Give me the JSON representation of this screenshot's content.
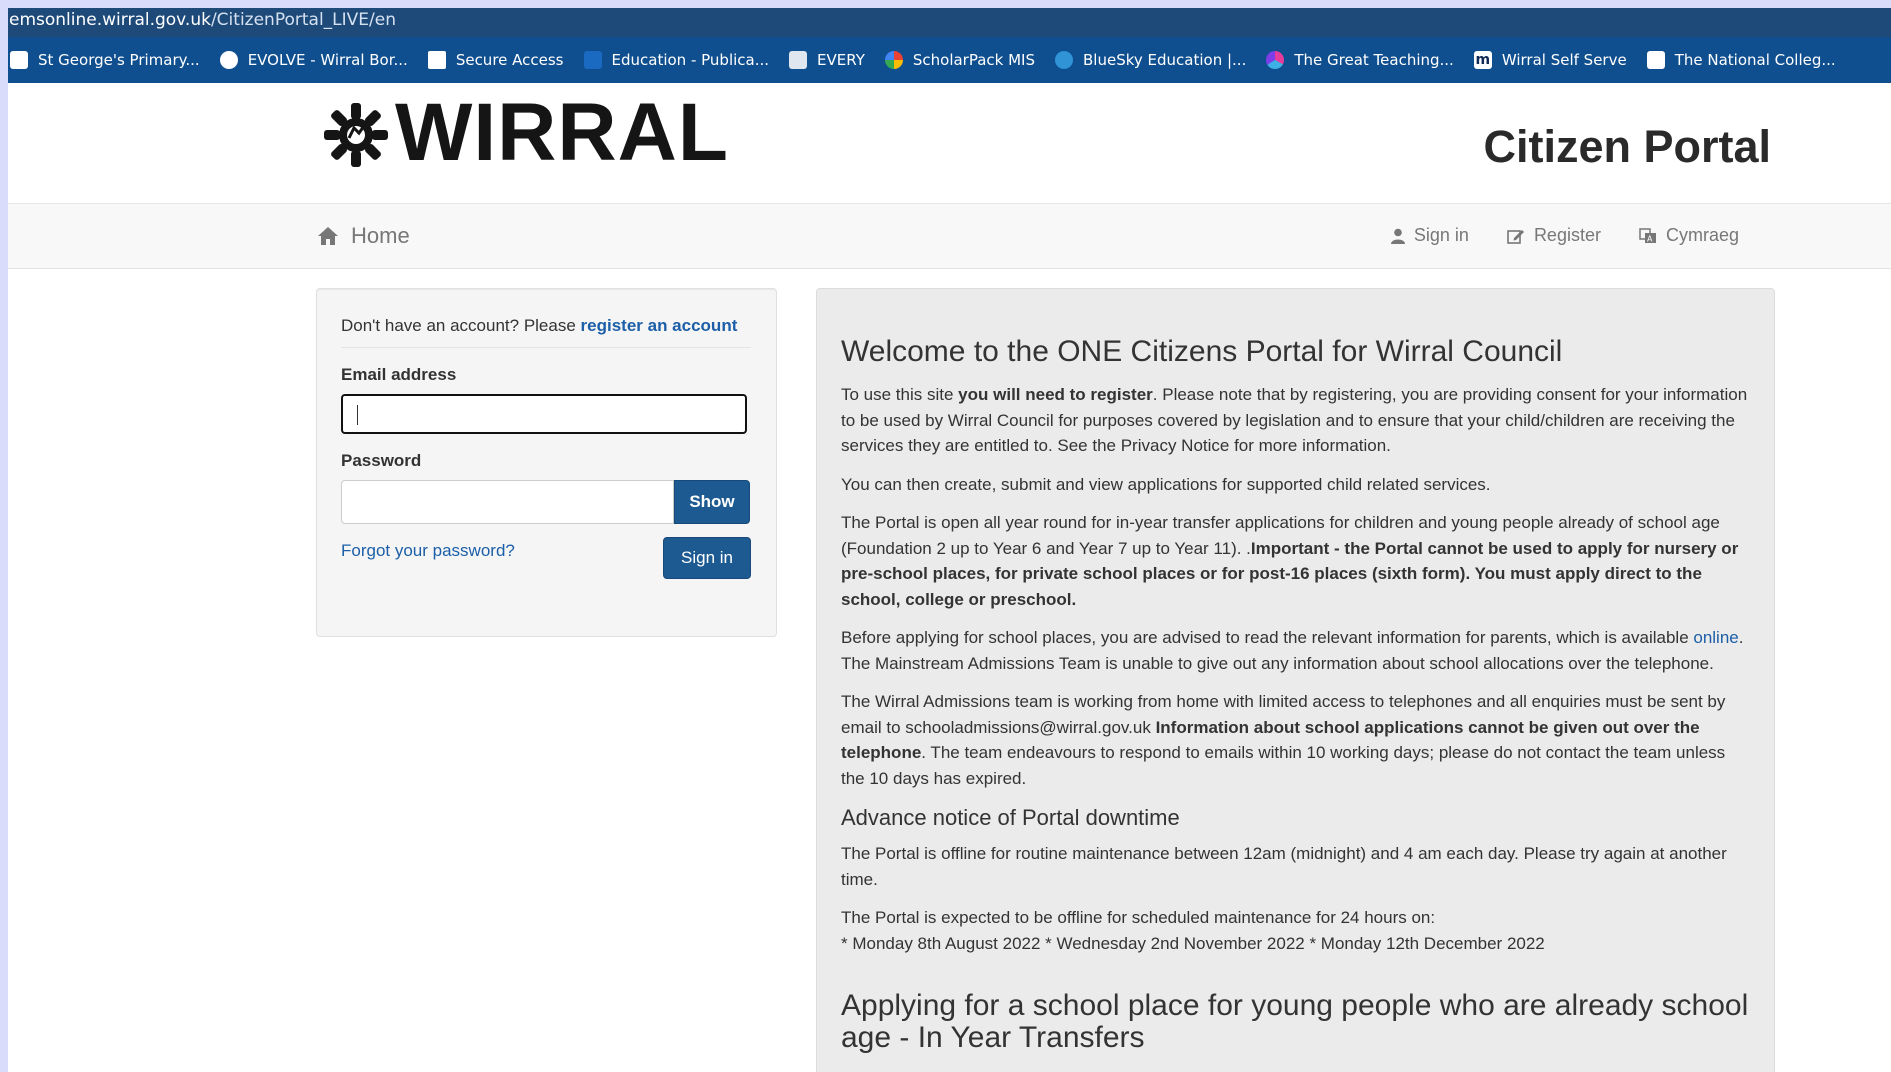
{
  "browser": {
    "url_domain": "emsonline.wirral.gov.uk",
    "url_path": "/CitizenPortal_LIVE/en",
    "bookmarks": [
      {
        "label": "St George's Primary...",
        "icon": "school-icon"
      },
      {
        "label": "EVOLVE - Wirral Bor...",
        "icon": "globe-icon"
      },
      {
        "label": "Secure Access",
        "icon": "crown-icon"
      },
      {
        "label": "Education - Publica...",
        "icon": "education-icon"
      },
      {
        "label": "EVERY",
        "icon": "document-icon"
      },
      {
        "label": "ScholarPack MIS",
        "icon": "scholarpack-icon"
      },
      {
        "label": "BlueSky Education |...",
        "icon": "cloud-icon"
      },
      {
        "label": "The Great Teaching...",
        "icon": "flower-icon"
      },
      {
        "label": "Wirral Self Serve",
        "icon": "m-icon"
      },
      {
        "label": "The National Colleg...",
        "icon": "college-icon"
      }
    ]
  },
  "header": {
    "logo_text": "WIRRAL",
    "title": "Citizen Portal"
  },
  "nav": {
    "home": "Home",
    "sign_in": "Sign in",
    "register": "Register",
    "language": "Cymraeg"
  },
  "login": {
    "no_account_text": "Don't have an account? Please ",
    "register_link": "register an account",
    "email_label": "Email address",
    "email_value": "",
    "password_label": "Password",
    "password_value": "",
    "show_button": "Show",
    "forgot_link": "Forgot your password?",
    "signin_button": "Sign in"
  },
  "info": {
    "welcome_heading": "Welcome to the ONE Citizens Portal for Wirral Council",
    "p1_a": "To use this site ",
    "p1_b": "you will need to register",
    "p1_c": ". Please note that by registering, you are providing consent for your information to be used by Wirral Council for purposes covered by legislation and to ensure that your child/children are receiving the services they are entitled to. See the Privacy Notice for more information.",
    "p2": "You can then create, submit and view applications for supported child related services.",
    "p3_a": "The Portal is open all year round for in-year transfer applications for children and young people already of school age (Foundation 2 up to Year 6 and Year 7 up to Year 11). .",
    "p3_b": "Important - the Portal cannot be used to apply for nursery or pre-school places, for private school places or for post-16 places (sixth form). You must apply direct to the school, college or preschool.",
    "p4_a": "Before applying for school places, you are advised to read the relevant information for parents, which is available ",
    "p4_link": "online",
    "p4_b": ". The Mainstream Admissions Team is unable to give out any information about school allocations over the telephone.",
    "p5_a": "The Wirral Admissions team is working from home with limited access to telephones and all enquiries must be sent by email to schooladmissions@wirral.gov.uk ",
    "p5_b": "Information about school applications cannot be given out over the telephone",
    "p5_c": ". The team endeavours to respond to emails within 10 working days; please do not contact the team unless the 10 days has expired.",
    "downtime_heading": "Advance notice of Portal downtime",
    "p6": "The Portal is offline for routine maintenance between 12am (midnight) and 4 am each day. Please try again at another time.",
    "p7_line1": "The Portal is expected to be offline for scheduled maintenance for 24 hours on:",
    "p7_line2": "* Monday 8th August 2022 * Wednesday 2nd November 2022 * Monday 12th December 2022",
    "transfer_heading": "Applying for a school place for young people who are already school age - In Year Transfers"
  },
  "colors": {
    "url_bar": "#1e4a7a",
    "bookmarks_bar": "#104f8f",
    "primary_button": "#1e5a92",
    "link": "#1c5fa8"
  }
}
